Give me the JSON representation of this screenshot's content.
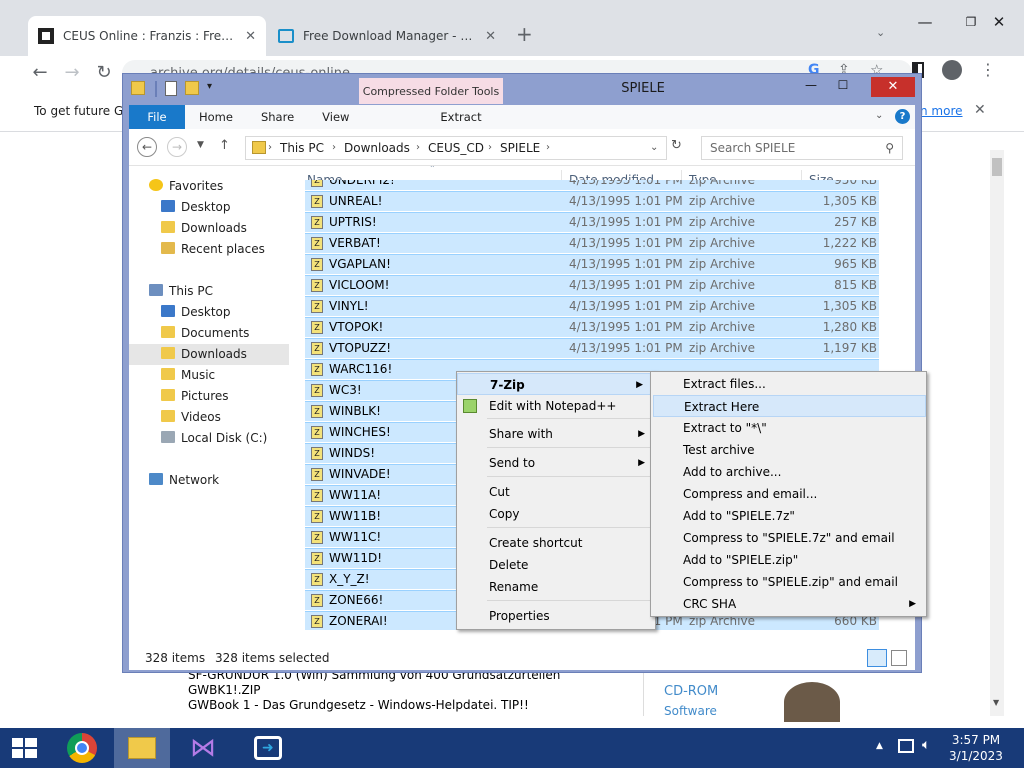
{
  "browser": {
    "tabs": [
      {
        "title": "CEUS Online : Franzis : Free Download",
        "active": true
      },
      {
        "title": "Free Download Manager - absolute",
        "active": false
      }
    ],
    "new_tab": "+",
    "url": "archive.org/details/ceus-online",
    "infobar_text": "To get future Go",
    "infobar_link": "n more",
    "infobar_close": "✕"
  },
  "page_behind": {
    "line1": "SF-GRUNDUR 1.0 (Win) Sammlung von 400 Grundsatzurteilen",
    "line2": "GWBK1!.ZIP",
    "line3": "GWBook 1 - Das Grundgesetz - Windows-Helpdatei. TIP!!",
    "side_link": "CD-ROM",
    "side_link2": "Software"
  },
  "explorer": {
    "title": "SPIELE",
    "contextual_tab": "Compressed Folder Tools",
    "ribbon_tabs": [
      "File",
      "Home",
      "Share",
      "View"
    ],
    "contextual_ribbon_tab": "Extract",
    "breadcrumb": [
      "This PC",
      "Downloads",
      "CEUS_CD",
      "SPIELE"
    ],
    "search_placeholder": "Search SPIELE",
    "columns": {
      "name": "Name",
      "date": "Date modified",
      "type": "Type",
      "size": "Size"
    },
    "nav": {
      "favorites": "Favorites",
      "fav_items": [
        "Desktop",
        "Downloads",
        "Recent places"
      ],
      "this_pc": "This PC",
      "pc_items": [
        "Desktop",
        "Documents",
        "Downloads",
        "Music",
        "Pictures",
        "Videos",
        "Local Disk (C:)"
      ],
      "network": "Network"
    },
    "files": [
      {
        "name": "UNDERFI2!",
        "date": "4/13/1995 1:01 PM",
        "type": "zip Archive",
        "size": "950 KB"
      },
      {
        "name": "UNREAL!",
        "date": "4/13/1995 1:01 PM",
        "type": "zip Archive",
        "size": "1,305 KB"
      },
      {
        "name": "UPTRIS!",
        "date": "4/13/1995 1:01 PM",
        "type": "zip Archive",
        "size": "257 KB"
      },
      {
        "name": "VERBAT!",
        "date": "4/13/1995 1:01 PM",
        "type": "zip Archive",
        "size": "1,222 KB"
      },
      {
        "name": "VGAPLAN!",
        "date": "4/13/1995 1:01 PM",
        "type": "zip Archive",
        "size": "965 KB"
      },
      {
        "name": "VICLOOM!",
        "date": "4/13/1995 1:01 PM",
        "type": "zip Archive",
        "size": "815 KB"
      },
      {
        "name": "VINYL!",
        "date": "4/13/1995 1:01 PM",
        "type": "zip Archive",
        "size": "1,305 KB"
      },
      {
        "name": "VTOPOK!",
        "date": "4/13/1995 1:01 PM",
        "type": "zip Archive",
        "size": "1,280 KB"
      },
      {
        "name": "VTOPUZZ!",
        "date": "4/13/1995 1:01 PM",
        "type": "zip Archive",
        "size": "1,197 KB"
      },
      {
        "name": "WARC116!",
        "date": "",
        "type": "",
        "size": ""
      },
      {
        "name": "WC3!",
        "date": "",
        "type": "",
        "size": ""
      },
      {
        "name": "WINBLK!",
        "date": "",
        "type": "",
        "size": ""
      },
      {
        "name": "WINCHES!",
        "date": "",
        "type": "",
        "size": ""
      },
      {
        "name": "WINDS!",
        "date": "",
        "type": "",
        "size": ""
      },
      {
        "name": "WINVADE!",
        "date": "",
        "type": "",
        "size": ""
      },
      {
        "name": "WW11A!",
        "date": "",
        "type": "",
        "size": ""
      },
      {
        "name": "WW11B!",
        "date": "",
        "type": "",
        "size": ""
      },
      {
        "name": "WW11C!",
        "date": "",
        "type": "",
        "size": ""
      },
      {
        "name": "WW11D!",
        "date": "",
        "type": "",
        "size": ""
      },
      {
        "name": "X_Y_Z!",
        "date": "",
        "type": "",
        "size": ""
      },
      {
        "name": "ZONE66!",
        "date": "",
        "type": "",
        "size": ""
      },
      {
        "name": "ZONERAI!",
        "date": "4/13/1995 1:01 PM",
        "type": "zip Archive",
        "size": "660 KB"
      }
    ],
    "status_items": "328 items",
    "status_selected": "328 items selected"
  },
  "context_menu": {
    "items": [
      {
        "label": "7-Zip",
        "submenu": true
      },
      {
        "label": "Edit with Notepad++",
        "submenu": false
      },
      {
        "label": "Share with",
        "submenu": true
      },
      {
        "label": "Send to",
        "submenu": true
      },
      {
        "label": "Cut",
        "submenu": false
      },
      {
        "label": "Copy",
        "submenu": false
      },
      {
        "label": "Create shortcut",
        "submenu": false
      },
      {
        "label": "Delete",
        "submenu": false
      },
      {
        "label": "Rename",
        "submenu": false
      },
      {
        "label": "Properties",
        "submenu": false
      }
    ]
  },
  "sevenzip_menu": {
    "items": [
      {
        "label": "Extract files..."
      },
      {
        "label": "Extract Here"
      },
      {
        "label": "Extract to \"*\\\""
      },
      {
        "label": "Test archive"
      },
      {
        "label": "Add to archive..."
      },
      {
        "label": "Compress and email..."
      },
      {
        "label": "Add to \"SPIELE.7z\""
      },
      {
        "label": "Compress to \"SPIELE.7z\" and email"
      },
      {
        "label": "Add to \"SPIELE.zip\""
      },
      {
        "label": "Compress to \"SPIELE.zip\" and email"
      },
      {
        "label": "CRC SHA"
      }
    ]
  },
  "taskbar": {
    "time": "3:57 PM",
    "date": "3/1/2023"
  },
  "colors": {
    "selection": "#cce8ff",
    "explorer_frame": "#8e9fcf",
    "taskbar": "#183a78",
    "close_red": "#c7302b",
    "file_tab_blue": "#1979ca"
  }
}
